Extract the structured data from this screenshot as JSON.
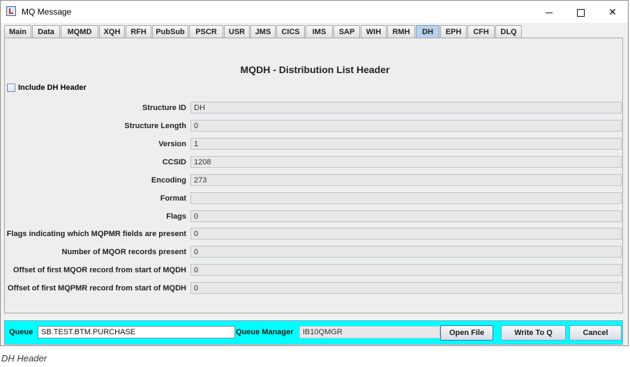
{
  "window": {
    "title": "MQ Message"
  },
  "tabs": [
    "Main",
    "Data",
    "MQMD",
    "XQH",
    "RFH",
    "PubSub",
    "PSCR",
    "USR",
    "JMS",
    "CICS",
    "IMS",
    "SAP",
    "WIH",
    "RMH",
    "DH",
    "EPH",
    "CFH",
    "DLQ"
  ],
  "active_tab": "DH",
  "panel": {
    "title": "MQDH - Distribution List Header",
    "include_label": "Include DH Header",
    "include_checked": false,
    "fields": [
      {
        "label": "Structure ID",
        "value": "DH"
      },
      {
        "label": "Structure Length",
        "value": "0"
      },
      {
        "label": "Version",
        "value": "1"
      },
      {
        "label": "CCSID",
        "value": "1208"
      },
      {
        "label": "Encoding",
        "value": "273"
      },
      {
        "label": "Format",
        "value": ""
      },
      {
        "label": "Flags",
        "value": "0"
      },
      {
        "label": "Flags indicating which MQPMR fields are present",
        "value": "0"
      },
      {
        "label": "Number of MQOR records present",
        "value": "0"
      },
      {
        "label": "Offset of first MQOR record from start of MQDH",
        "value": "0"
      },
      {
        "label": "Offset of first MQPMR record from start of MQDH",
        "value": "0"
      }
    ]
  },
  "bottom": {
    "queue_label": "Queue",
    "queue_value": "SB.TEST.BTM.PURCHASE",
    "queue_manager_label": "Queue Manager",
    "queue_manager_value": "IB10QMGR",
    "open_file": "Open File",
    "write_to_q": "Write To Q",
    "cancel": "Cancel"
  },
  "caption": "DH Header",
  "colors": {
    "bottom_bar": "#00ffff",
    "active_tab": "#b9d1ea"
  }
}
